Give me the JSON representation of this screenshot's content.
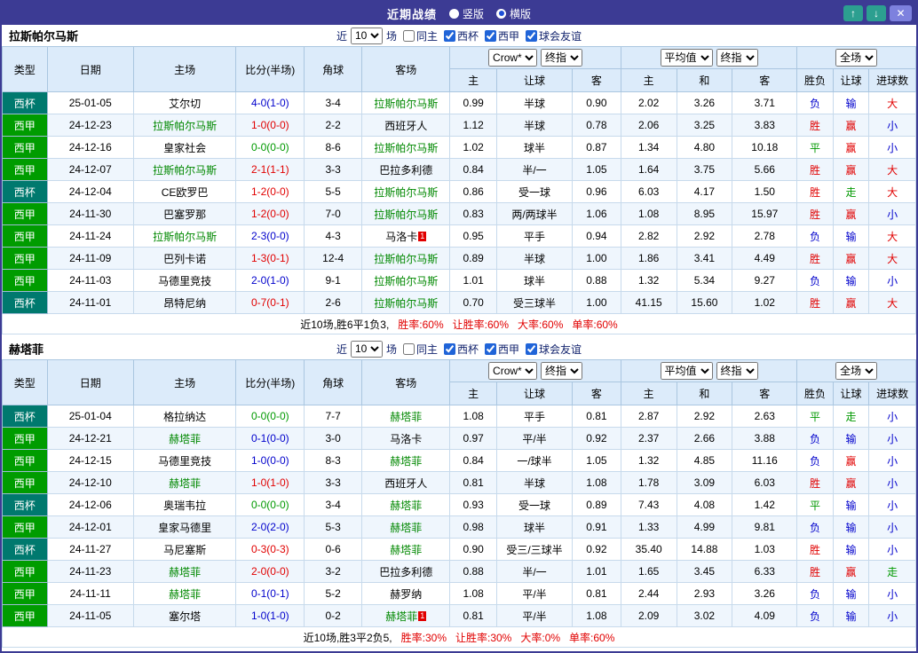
{
  "titlebar": {
    "title": "近期战绩",
    "radios": [
      {
        "label": "竖版",
        "checked": false
      },
      {
        "label": "横版",
        "checked": true
      }
    ],
    "buttons": {
      "up": "↑",
      "down": "↓",
      "close": "✕"
    }
  },
  "colors": {
    "titlebar_bg": "#3c3b94",
    "header_bg": "#dcebfa",
    "cup_badge": "#00796e",
    "liga_badge": "#009c00",
    "focal_team": "#008800",
    "win_red": "#e10000",
    "draw_green": "#009900",
    "loss_blue": "#0000cc",
    "up_down_btn": "#2c9f90",
    "close_btn": "#7d81de"
  },
  "filter": {
    "near": "近",
    "count": "10",
    "games": "场",
    "checkboxes": [
      {
        "label": "同主",
        "checked": false
      },
      {
        "label": "西杯",
        "checked": true
      },
      {
        "label": "西甲",
        "checked": true
      },
      {
        "label": "球会友谊",
        "checked": true
      }
    ]
  },
  "header": {
    "static_cols": [
      "类型",
      "日期",
      "主场",
      "比分(半场)",
      "角球",
      "客场"
    ],
    "groups": [
      {
        "selects": [
          "Crow*",
          "终指"
        ],
        "cols": [
          "主",
          "让球",
          "客"
        ]
      },
      {
        "selects": [
          "平均值",
          "终指"
        ],
        "cols": [
          "主",
          "和",
          "客"
        ]
      },
      {
        "selects": [
          "全场"
        ],
        "cols": [
          "胜负",
          "让球",
          "进球数"
        ]
      }
    ]
  },
  "sections": [
    {
      "team": "拉斯帕尔马斯",
      "rows": [
        {
          "league": "西杯",
          "comp": "cup",
          "date": "25-01-05",
          "home": "艾尔切",
          "home_focal": false,
          "home_rc": "",
          "score": "4-0(1-0)",
          "score_res": "loss",
          "corners": "3-4",
          "away": "拉斯帕尔马斯",
          "away_focal": true,
          "away_rc": "",
          "hcp": [
            "0.99",
            "半球",
            "0.90"
          ],
          "avg": [
            "2.02",
            "3.26",
            "3.71"
          ],
          "wdl": "负",
          "wdl_res": "loss",
          "hres": "输",
          "hres_res": "loss",
          "size": "大",
          "size_res": "win"
        },
        {
          "league": "西甲",
          "comp": "liga",
          "date": "24-12-23",
          "home": "拉斯帕尔马斯",
          "home_focal": true,
          "home_rc": "",
          "score": "1-0(0-0)",
          "score_res": "win",
          "corners": "2-2",
          "away": "西班牙人",
          "away_focal": false,
          "away_rc": "",
          "hcp": [
            "1.12",
            "半球",
            "0.78"
          ],
          "avg": [
            "2.06",
            "3.25",
            "3.83"
          ],
          "wdl": "胜",
          "wdl_res": "win",
          "hres": "赢",
          "hres_res": "win",
          "size": "小",
          "size_res": "loss"
        },
        {
          "league": "西甲",
          "comp": "liga",
          "date": "24-12-16",
          "home": "皇家社会",
          "home_focal": false,
          "home_rc": "",
          "score": "0-0(0-0)",
          "score_res": "draw",
          "corners": "8-6",
          "away": "拉斯帕尔马斯",
          "away_focal": true,
          "away_rc": "",
          "hcp": [
            "1.02",
            "球半",
            "0.87"
          ],
          "avg": [
            "1.34",
            "4.80",
            "10.18"
          ],
          "wdl": "平",
          "wdl_res": "draw",
          "hres": "赢",
          "hres_res": "win",
          "size": "小",
          "size_res": "loss"
        },
        {
          "league": "西甲",
          "comp": "liga",
          "date": "24-12-07",
          "home": "拉斯帕尔马斯",
          "home_focal": true,
          "home_rc": "",
          "score": "2-1(1-1)",
          "score_res": "win",
          "corners": "3-3",
          "away": "巴拉多利德",
          "away_focal": false,
          "away_rc": "",
          "hcp": [
            "0.84",
            "半/一",
            "1.05"
          ],
          "avg": [
            "1.64",
            "3.75",
            "5.66"
          ],
          "wdl": "胜",
          "wdl_res": "win",
          "hres": "赢",
          "hres_res": "win",
          "size": "大",
          "size_res": "win"
        },
        {
          "league": "西杯",
          "comp": "cup",
          "date": "24-12-04",
          "home": "CE欧罗巴",
          "home_focal": false,
          "home_rc": "",
          "score": "1-2(0-0)",
          "score_res": "win",
          "corners": "5-5",
          "away": "拉斯帕尔马斯",
          "away_focal": true,
          "away_rc": "",
          "hcp": [
            "0.86",
            "受一球",
            "0.96"
          ],
          "avg": [
            "6.03",
            "4.17",
            "1.50"
          ],
          "wdl": "胜",
          "wdl_res": "win",
          "hres": "走",
          "hres_res": "draw",
          "size": "大",
          "size_res": "win"
        },
        {
          "league": "西甲",
          "comp": "liga",
          "date": "24-11-30",
          "home": "巴塞罗那",
          "home_focal": false,
          "home_rc": "",
          "score": "1-2(0-0)",
          "score_res": "win",
          "corners": "7-0",
          "away": "拉斯帕尔马斯",
          "away_focal": true,
          "away_rc": "",
          "hcp": [
            "0.83",
            "两/两球半",
            "1.06"
          ],
          "avg": [
            "1.08",
            "8.95",
            "15.97"
          ],
          "wdl": "胜",
          "wdl_res": "win",
          "hres": "赢",
          "hres_res": "win",
          "size": "小",
          "size_res": "loss"
        },
        {
          "league": "西甲",
          "comp": "liga",
          "date": "24-11-24",
          "home": "拉斯帕尔马斯",
          "home_focal": true,
          "home_rc": "",
          "score": "2-3(0-0)",
          "score_res": "loss",
          "corners": "4-3",
          "away": "马洛卡",
          "away_focal": false,
          "away_rc": "1",
          "hcp": [
            "0.95",
            "平手",
            "0.94"
          ],
          "avg": [
            "2.82",
            "2.92",
            "2.78"
          ],
          "wdl": "负",
          "wdl_res": "loss",
          "hres": "输",
          "hres_res": "loss",
          "size": "大",
          "size_res": "win"
        },
        {
          "league": "西甲",
          "comp": "liga",
          "date": "24-11-09",
          "home": "巴列卡诺",
          "home_focal": false,
          "home_rc": "",
          "score": "1-3(0-1)",
          "score_res": "win",
          "corners": "12-4",
          "away": "拉斯帕尔马斯",
          "away_focal": true,
          "away_rc": "",
          "hcp": [
            "0.89",
            "半球",
            "1.00"
          ],
          "avg": [
            "1.86",
            "3.41",
            "4.49"
          ],
          "wdl": "胜",
          "wdl_res": "win",
          "hres": "赢",
          "hres_res": "win",
          "size": "大",
          "size_res": "win"
        },
        {
          "league": "西甲",
          "comp": "liga",
          "date": "24-11-03",
          "home": "马德里竞技",
          "home_focal": false,
          "home_rc": "",
          "score": "2-0(1-0)",
          "score_res": "loss",
          "corners": "9-1",
          "away": "拉斯帕尔马斯",
          "away_focal": true,
          "away_rc": "",
          "hcp": [
            "1.01",
            "球半",
            "0.88"
          ],
          "avg": [
            "1.32",
            "5.34",
            "9.27"
          ],
          "wdl": "负",
          "wdl_res": "loss",
          "hres": "输",
          "hres_res": "loss",
          "size": "小",
          "size_res": "loss"
        },
        {
          "league": "西杯",
          "comp": "cup",
          "date": "24-11-01",
          "home": "昂特尼纳",
          "home_focal": false,
          "home_rc": "",
          "score": "0-7(0-1)",
          "score_res": "win",
          "corners": "2-6",
          "away": "拉斯帕尔马斯",
          "away_focal": true,
          "away_rc": "",
          "hcp": [
            "0.70",
            "受三球半",
            "1.00"
          ],
          "avg": [
            "41.15",
            "15.60",
            "1.02"
          ],
          "wdl": "胜",
          "wdl_res": "win",
          "hres": "赢",
          "hres_res": "win",
          "size": "大",
          "size_res": "win"
        }
      ],
      "summary": {
        "prefix": "近10场,胜6平1负3,",
        "stats": [
          "胜率:60%",
          "让胜率:60%",
          "大率:60%",
          "单率:60%"
        ]
      }
    },
    {
      "team": "赫塔菲",
      "rows": [
        {
          "league": "西杯",
          "comp": "cup",
          "date": "25-01-04",
          "home": "格拉纳达",
          "home_focal": false,
          "home_rc": "",
          "score": "0-0(0-0)",
          "score_res": "draw",
          "corners": "7-7",
          "away": "赫塔菲",
          "away_focal": true,
          "away_rc": "",
          "hcp": [
            "1.08",
            "平手",
            "0.81"
          ],
          "avg": [
            "2.87",
            "2.92",
            "2.63"
          ],
          "wdl": "平",
          "wdl_res": "draw",
          "hres": "走",
          "hres_res": "draw",
          "size": "小",
          "size_res": "loss"
        },
        {
          "league": "西甲",
          "comp": "liga",
          "date": "24-12-21",
          "home": "赫塔菲",
          "home_focal": true,
          "home_rc": "",
          "score": "0-1(0-0)",
          "score_res": "loss",
          "corners": "3-0",
          "away": "马洛卡",
          "away_focal": false,
          "away_rc": "",
          "hcp": [
            "0.97",
            "平/半",
            "0.92"
          ],
          "avg": [
            "2.37",
            "2.66",
            "3.88"
          ],
          "wdl": "负",
          "wdl_res": "loss",
          "hres": "输",
          "hres_res": "loss",
          "size": "小",
          "size_res": "loss"
        },
        {
          "league": "西甲",
          "comp": "liga",
          "date": "24-12-15",
          "home": "马德里竞技",
          "home_focal": false,
          "home_rc": "",
          "score": "1-0(0-0)",
          "score_res": "loss",
          "corners": "8-3",
          "away": "赫塔菲",
          "away_focal": true,
          "away_rc": "",
          "hcp": [
            "0.84",
            "一/球半",
            "1.05"
          ],
          "avg": [
            "1.32",
            "4.85",
            "11.16"
          ],
          "wdl": "负",
          "wdl_res": "loss",
          "hres": "赢",
          "hres_res": "win",
          "size": "小",
          "size_res": "loss"
        },
        {
          "league": "西甲",
          "comp": "liga",
          "date": "24-12-10",
          "home": "赫塔菲",
          "home_focal": true,
          "home_rc": "",
          "score": "1-0(1-0)",
          "score_res": "win",
          "corners": "3-3",
          "away": "西班牙人",
          "away_focal": false,
          "away_rc": "",
          "hcp": [
            "0.81",
            "半球",
            "1.08"
          ],
          "avg": [
            "1.78",
            "3.09",
            "6.03"
          ],
          "wdl": "胜",
          "wdl_res": "win",
          "hres": "赢",
          "hres_res": "win",
          "size": "小",
          "size_res": "loss"
        },
        {
          "league": "西杯",
          "comp": "cup",
          "date": "24-12-06",
          "home": "奥瑞韦拉",
          "home_focal": false,
          "home_rc": "",
          "score": "0-0(0-0)",
          "score_res": "draw",
          "corners": "3-4",
          "away": "赫塔菲",
          "away_focal": true,
          "away_rc": "",
          "hcp": [
            "0.93",
            "受一球",
            "0.89"
          ],
          "avg": [
            "7.43",
            "4.08",
            "1.42"
          ],
          "wdl": "平",
          "wdl_res": "draw",
          "hres": "输",
          "hres_res": "loss",
          "size": "小",
          "size_res": "loss"
        },
        {
          "league": "西甲",
          "comp": "liga",
          "date": "24-12-01",
          "home": "皇家马德里",
          "home_focal": false,
          "home_rc": "",
          "score": "2-0(2-0)",
          "score_res": "loss",
          "corners": "5-3",
          "away": "赫塔菲",
          "away_focal": true,
          "away_rc": "",
          "hcp": [
            "0.98",
            "球半",
            "0.91"
          ],
          "avg": [
            "1.33",
            "4.99",
            "9.81"
          ],
          "wdl": "负",
          "wdl_res": "loss",
          "hres": "输",
          "hres_res": "loss",
          "size": "小",
          "size_res": "loss"
        },
        {
          "league": "西杯",
          "comp": "cup",
          "date": "24-11-27",
          "home": "马尼塞斯",
          "home_focal": false,
          "home_rc": "",
          "score": "0-3(0-3)",
          "score_res": "win",
          "corners": "0-6",
          "away": "赫塔菲",
          "away_focal": true,
          "away_rc": "",
          "hcp": [
            "0.90",
            "受三/三球半",
            "0.92"
          ],
          "avg": [
            "35.40",
            "14.88",
            "1.03"
          ],
          "wdl": "胜",
          "wdl_res": "win",
          "hres": "输",
          "hres_res": "loss",
          "size": "小",
          "size_res": "loss"
        },
        {
          "league": "西甲",
          "comp": "liga",
          "date": "24-11-23",
          "home": "赫塔菲",
          "home_focal": true,
          "home_rc": "",
          "score": "2-0(0-0)",
          "score_res": "win",
          "corners": "3-2",
          "away": "巴拉多利德",
          "away_focal": false,
          "away_rc": "",
          "hcp": [
            "0.88",
            "半/一",
            "1.01"
          ],
          "avg": [
            "1.65",
            "3.45",
            "6.33"
          ],
          "wdl": "胜",
          "wdl_res": "win",
          "hres": "赢",
          "hres_res": "win",
          "size": "走",
          "size_res": "draw"
        },
        {
          "league": "西甲",
          "comp": "liga",
          "date": "24-11-11",
          "home": "赫塔菲",
          "home_focal": true,
          "home_rc": "",
          "score": "0-1(0-1)",
          "score_res": "loss",
          "corners": "5-2",
          "away": "赫罗纳",
          "away_focal": false,
          "away_rc": "",
          "hcp": [
            "1.08",
            "平/半",
            "0.81"
          ],
          "avg": [
            "2.44",
            "2.93",
            "3.26"
          ],
          "wdl": "负",
          "wdl_res": "loss",
          "hres": "输",
          "hres_res": "loss",
          "size": "小",
          "size_res": "loss"
        },
        {
          "league": "西甲",
          "comp": "liga",
          "date": "24-11-05",
          "home": "塞尔塔",
          "home_focal": false,
          "home_rc": "",
          "score": "1-0(1-0)",
          "score_res": "loss",
          "corners": "0-2",
          "away": "赫塔菲",
          "away_focal": true,
          "away_rc": "1",
          "hcp": [
            "0.81",
            "平/半",
            "1.08"
          ],
          "avg": [
            "2.09",
            "3.02",
            "4.09"
          ],
          "wdl": "负",
          "wdl_res": "loss",
          "hres": "输",
          "hres_res": "loss",
          "size": "小",
          "size_res": "loss"
        }
      ],
      "summary": {
        "prefix": "近10场,胜3平2负5,",
        "stats": [
          "胜率:30%",
          "让胜率:30%",
          "大率:0%",
          "单率:60%"
        ]
      }
    }
  ]
}
